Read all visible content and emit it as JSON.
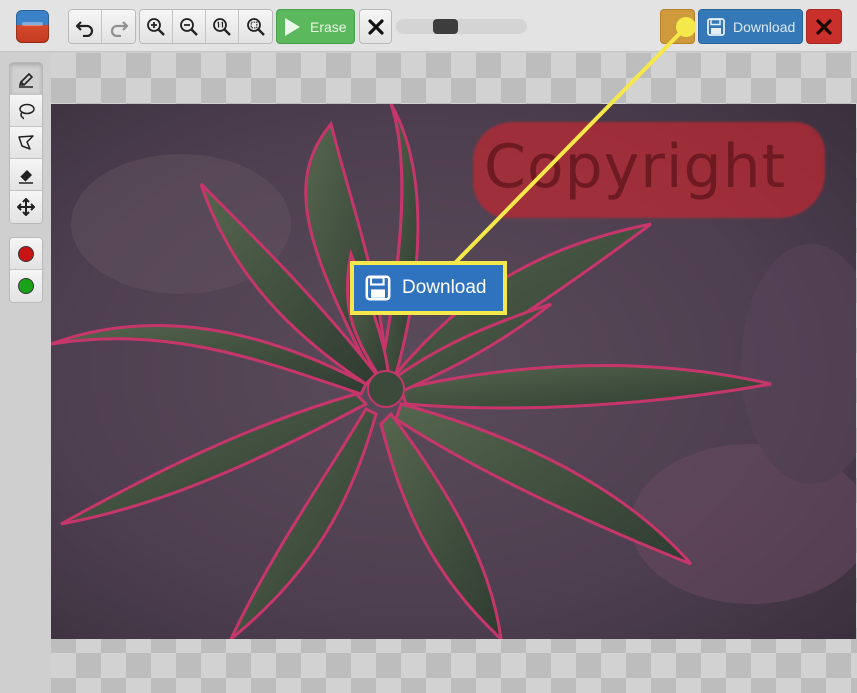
{
  "toolbar": {
    "erase_label": "Erase",
    "download_label": "Download",
    "brush_level": 0.35,
    "icons": {
      "logo": "app-logo-icon",
      "undo": "undo-icon",
      "redo": "redo-icon",
      "zoom_in": "zoom-in-icon",
      "zoom_out": "zoom-out-icon",
      "zoom_actual": "zoom-actual-size-icon",
      "zoom_fit": "zoom-fit-icon",
      "erase": "play-icon",
      "cancel": "close-icon",
      "help": "help-icon",
      "download": "floppy-disk-icon",
      "exit": "close-icon"
    },
    "colors": {
      "erase": "#5cb85c",
      "download": "#3478b7",
      "exit": "#c9302c",
      "help": "#cf9a3c"
    }
  },
  "tools": {
    "items": [
      "marker-icon",
      "lasso-icon",
      "polygon-lasso-icon",
      "eraser-icon",
      "move-icon"
    ],
    "active": "marker-icon",
    "colors": [
      "#c81414",
      "#1aa31a"
    ]
  },
  "canvas": {
    "watermark_text": "Copyright"
  },
  "callout": {
    "label": "Download",
    "icon": "floppy-disk-icon",
    "border_color": "#f4e84a"
  }
}
